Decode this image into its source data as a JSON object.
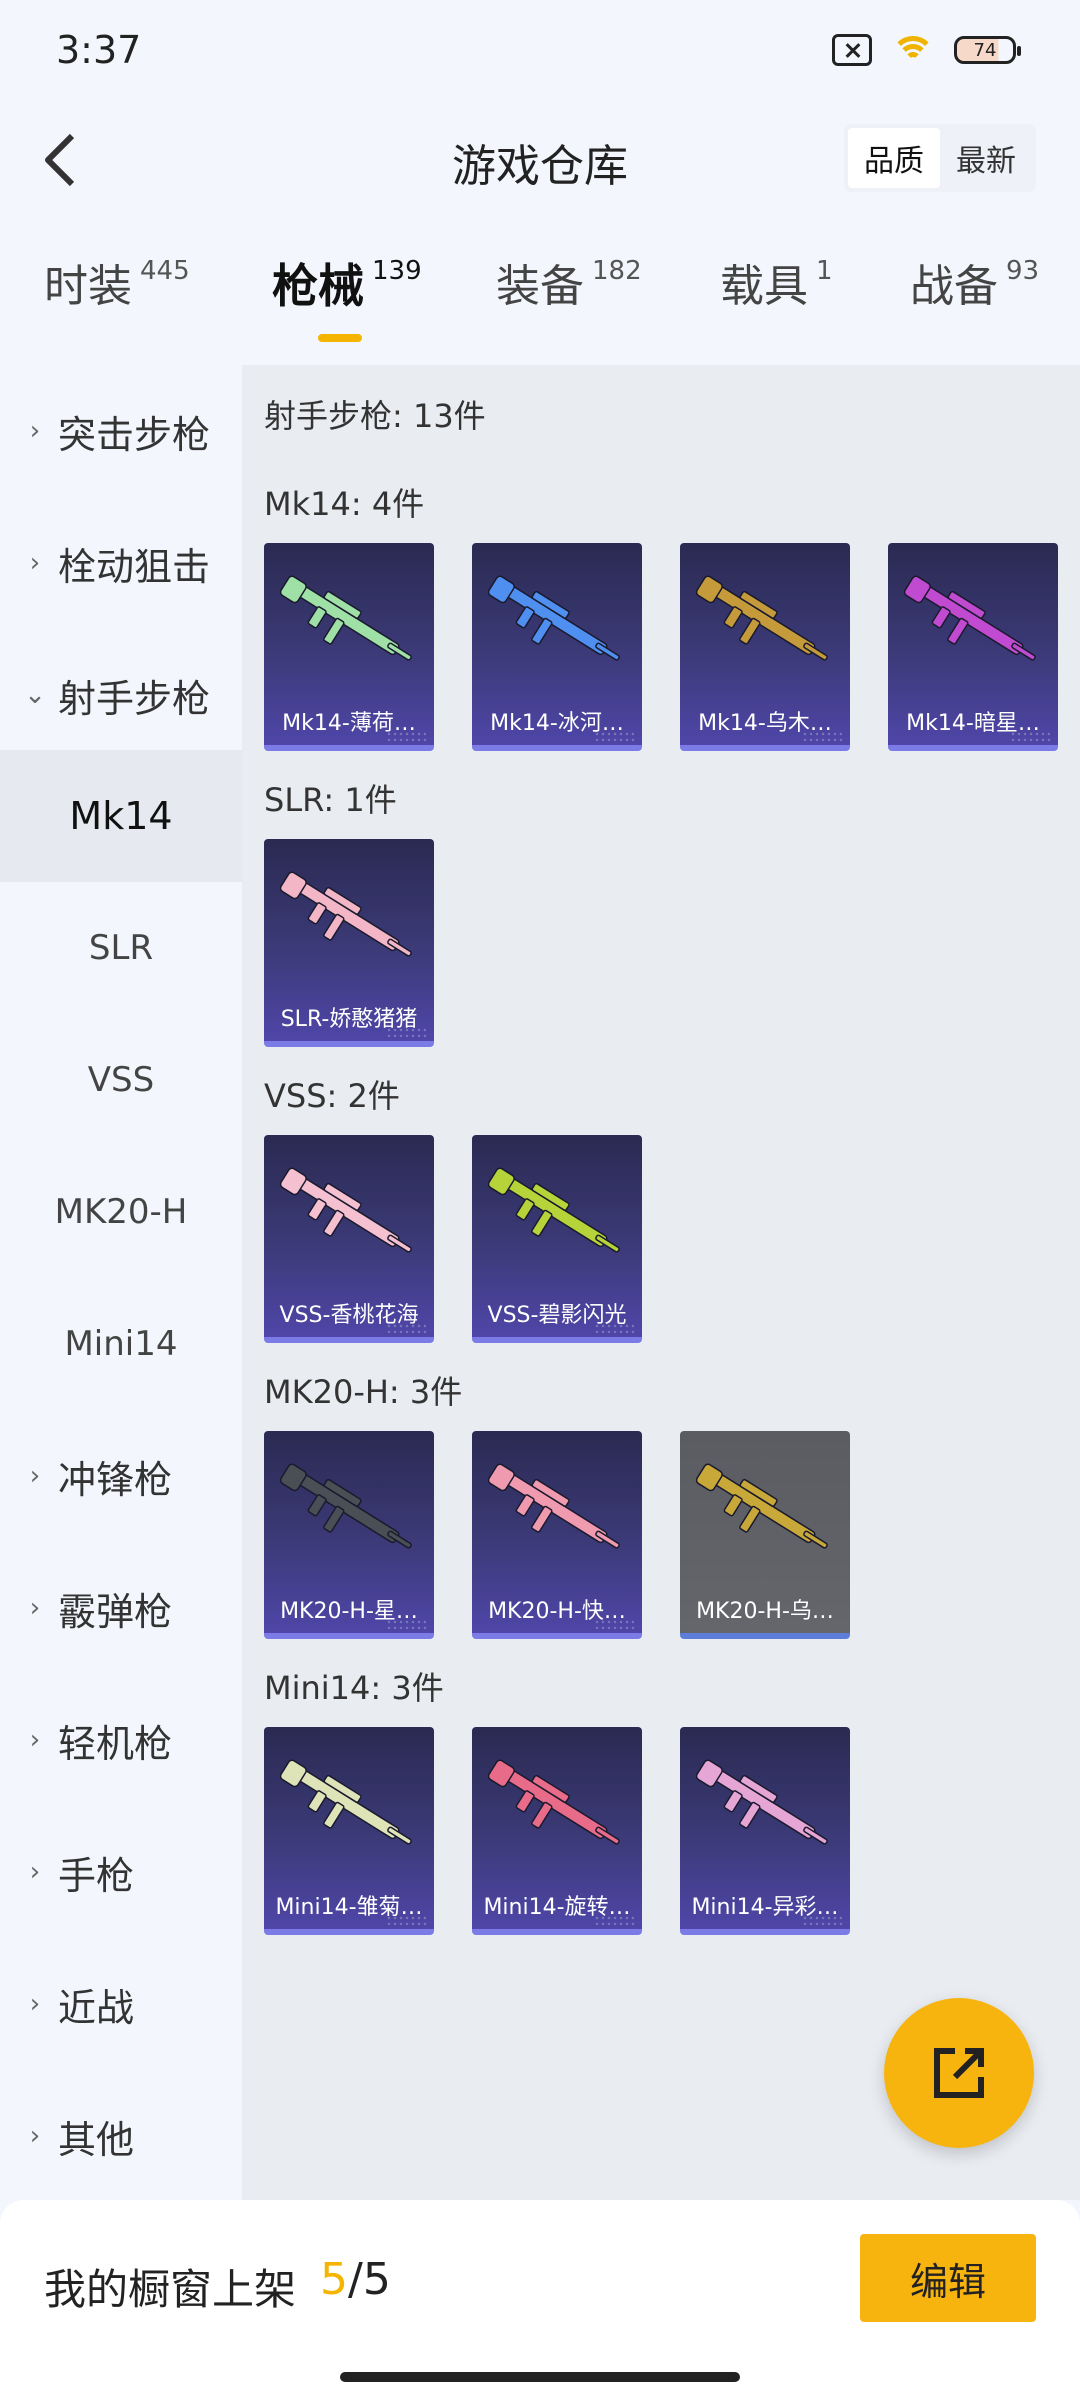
{
  "status": {
    "time": "3:37",
    "battery": "74"
  },
  "header": {
    "title": "游戏仓库",
    "sort_options": [
      {
        "label": "品质",
        "active": true
      },
      {
        "label": "最新",
        "active": false
      }
    ]
  },
  "tabs": [
    {
      "label": "时装",
      "count": "445"
    },
    {
      "label": "枪械",
      "count": "139",
      "active": true
    },
    {
      "label": "装备",
      "count": "182"
    },
    {
      "label": "载具",
      "count": "1"
    },
    {
      "label": "战备",
      "count": "93"
    }
  ],
  "sidebar": {
    "categories": [
      {
        "label": "突击步枪"
      },
      {
        "label": "栓动狙击"
      },
      {
        "label": "射手步枪",
        "expanded": true
      },
      {
        "label": "冲锋枪"
      },
      {
        "label": "霰弹枪"
      },
      {
        "label": "轻机枪"
      },
      {
        "label": "手枪"
      },
      {
        "label": "近战"
      },
      {
        "label": "其他"
      }
    ],
    "subcategories": [
      {
        "label": "Mk14",
        "active": true
      },
      {
        "label": "SLR"
      },
      {
        "label": "VSS"
      },
      {
        "label": "MK20-H"
      },
      {
        "label": "Mini14"
      }
    ]
  },
  "content": {
    "section_title": "射手步枪: 13件",
    "groups": [
      {
        "title": "Mk14: 4件",
        "items": [
          "Mk14-薄荷…",
          "Mk14-冰河…",
          "Mk14-乌木…",
          "Mk14-暗星…"
        ]
      },
      {
        "title": "SLR: 1件",
        "items": [
          "SLR-娇憨猪猪"
        ]
      },
      {
        "title": "VSS: 2件",
        "items": [
          "VSS-香桃花海",
          "VSS-碧影闪光"
        ]
      },
      {
        "title": "MK20-H: 3件",
        "items": [
          "MK20-H-星…",
          "MK20-H-快…",
          "MK20-H-乌…"
        ]
      },
      {
        "title": "Mini14: 3件",
        "items": [
          "Mini14-雏菊…",
          "Mini14-旋转…",
          "Mini14-异彩…"
        ]
      }
    ]
  },
  "bottom_bar": {
    "label": "我的橱窗上架",
    "current": "5",
    "separator": "/",
    "total": "5",
    "edit_label": "编辑"
  },
  "colors": {
    "accent": "#f7b40f",
    "card_bg": "#3c3a78",
    "content_bg": "#e9ecf1",
    "page_bg": "#f3f7fd"
  },
  "skin_colors": [
    "#9fe0a6",
    "#4f8ff0",
    "#c49a3a",
    "#c04ad0",
    "#f3b6c6",
    "#f5c1d0",
    "#b6d43a",
    "#4a4f55",
    "#f09ab0",
    "#c8a838",
    "#dfe3b8",
    "#e86c8a",
    "#e5a6d6"
  ]
}
